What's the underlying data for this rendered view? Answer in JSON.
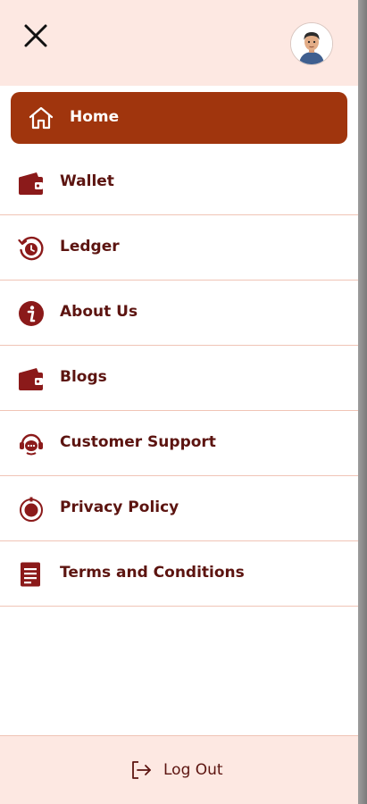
{
  "header": {
    "close_icon": "close-icon",
    "avatar": "user-avatar"
  },
  "menu": {
    "items": [
      {
        "label": "Home",
        "icon": "home-icon",
        "active": true
      },
      {
        "label": "Wallet",
        "icon": "wallet-icon"
      },
      {
        "label": "Ledger",
        "icon": "history-icon"
      },
      {
        "label": "About Us",
        "icon": "info-icon"
      },
      {
        "label": "Blogs",
        "icon": "wallet-icon"
      },
      {
        "label": "Customer Support",
        "icon": "support-chat-icon"
      },
      {
        "label": "Privacy Policy",
        "icon": "privacy-icon"
      },
      {
        "label": "Terms and Conditions",
        "icon": "document-icon"
      }
    ]
  },
  "footer": {
    "logout_label": "Log Out",
    "logout_icon": "logout-icon"
  },
  "colors": {
    "accent": "#a0350d",
    "text": "#5c1410",
    "header_bg": "#fde8e2",
    "divider": "#f0c4b6"
  }
}
